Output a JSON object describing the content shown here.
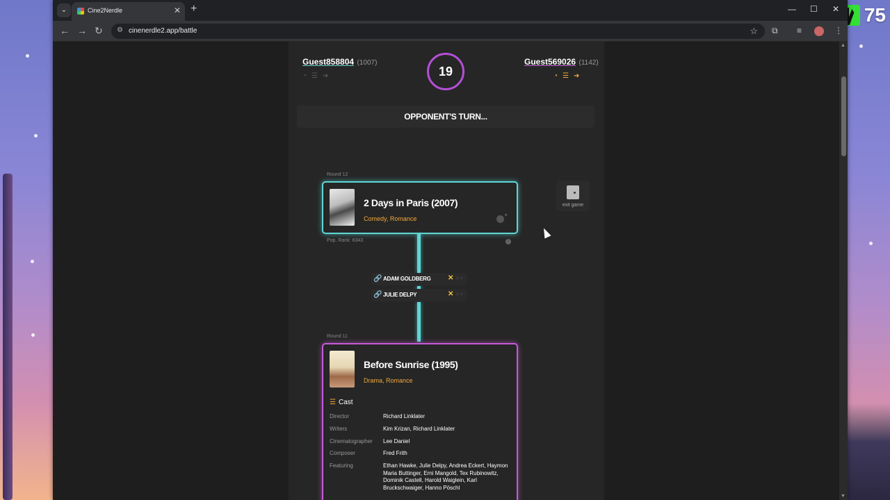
{
  "browser": {
    "tab_title": "Cine2Nerdle",
    "url": "cinenerdle2.app/battle",
    "new_tab": "+",
    "tab_close": "✕"
  },
  "overlay_badge": {
    "count": "75"
  },
  "players": {
    "left": {
      "name": "Guest858804",
      "rating": "(1007)"
    },
    "right": {
      "name": "Guest569026",
      "rating": "(1142)"
    }
  },
  "timer": {
    "value": "19"
  },
  "turn_banner": "OPPONENT'S TURN...",
  "exit_button": "exit game",
  "round12": {
    "label": "Round 12",
    "title": "2 Days in Paris (2007)",
    "genres": "Comedy, Romance",
    "pop_rank": "Pop. Rank: 6343"
  },
  "links": [
    {
      "name": "ADAM GOLDBERG",
      "mark": "✕",
      "marks_off": "✕✕"
    },
    {
      "name": "JULIE DELPY",
      "mark": "✕",
      "marks_off": "✕✕"
    }
  ],
  "round11": {
    "label": "Round 11",
    "title": "Before Sunrise (1995)",
    "genres": "Drama, Romance",
    "cast_label": "Cast",
    "credits": [
      {
        "role": "Director",
        "value": "Richard Linklater"
      },
      {
        "role": "Writers",
        "value": "Kim Krizan, Richard Linklater"
      },
      {
        "role": "Cinematographer",
        "value": "Lee Daniel"
      },
      {
        "role": "Composer",
        "value": "Fred Frith"
      },
      {
        "role": "Featuring",
        "value": "Ethan Hawke, Julie Delpy, Andrea Eckert, Haymon Maria Buttinger, Erni Mangold, Tex Rubinowitz, Dominik Castell, Harold Waiglein, Karl Bruckschwaiger, Hanno Pöschl"
      }
    ]
  },
  "colors": {
    "left_player_accent": "#5ed6d6",
    "right_player_accent": "#c75ad8",
    "genre": "#f2a93b"
  }
}
